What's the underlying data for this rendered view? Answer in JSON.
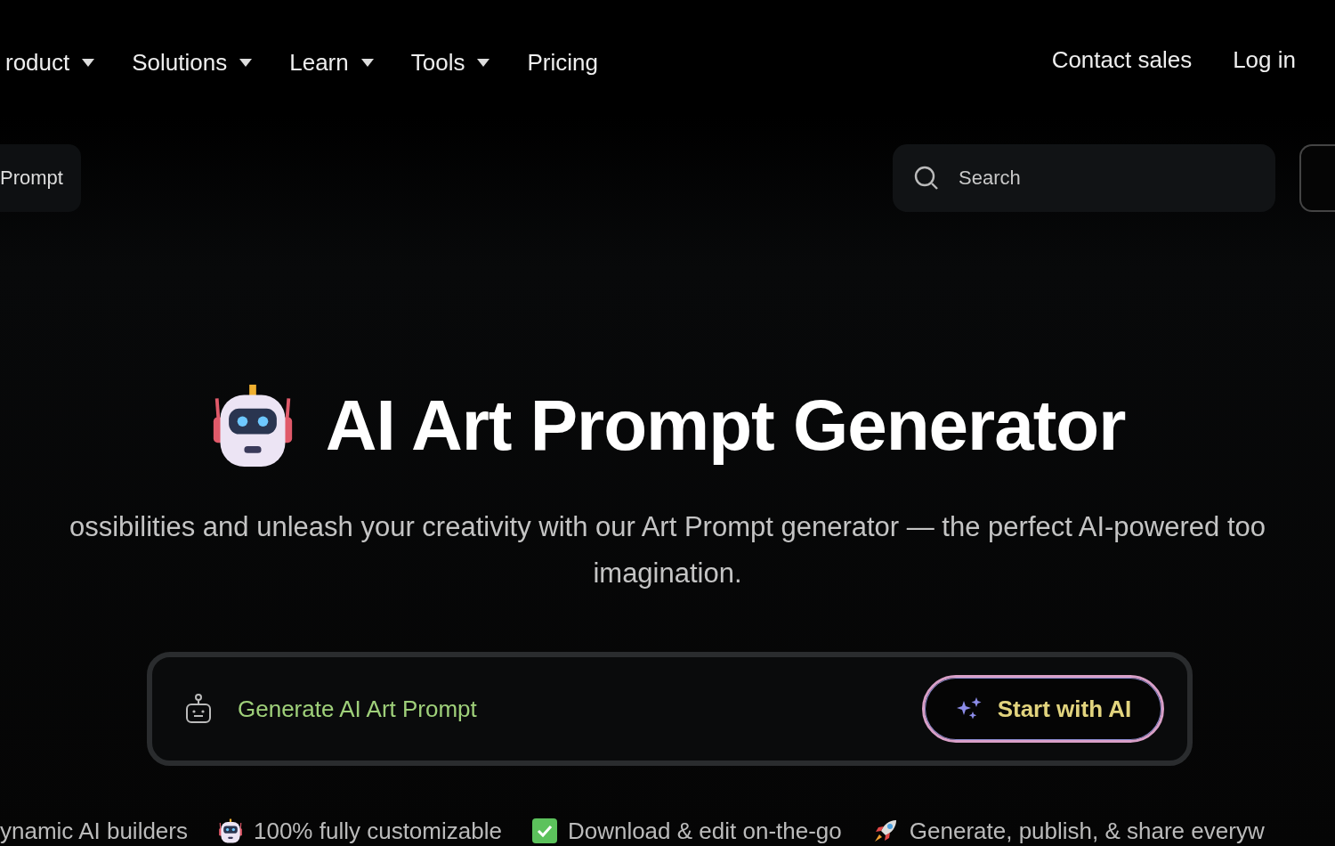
{
  "nav": {
    "items": [
      {
        "label": "roduct",
        "dropdown": true
      },
      {
        "label": "Solutions",
        "dropdown": true
      },
      {
        "label": "Learn",
        "dropdown": true
      },
      {
        "label": "Tools",
        "dropdown": true
      },
      {
        "label": "Pricing",
        "dropdown": false
      }
    ],
    "actions": [
      "Contact sales",
      "Log in"
    ]
  },
  "toolbar": {
    "chip": "Prompt",
    "search": {
      "placeholder": "Search"
    }
  },
  "hero": {
    "title": "AI Art Prompt Generator",
    "subtitle": [
      "ossibilities and unleash your creativity with our Art Prompt generator — the perfect AI-powered too",
      "imagination."
    ]
  },
  "prompt_bar": {
    "placeholder": "Generate AI Art Prompt",
    "button": "Start with AI"
  },
  "features": [
    {
      "kind": "plain",
      "text": "ynamic AI builders"
    },
    {
      "kind": "robot",
      "text": "100% fully customizable"
    },
    {
      "kind": "check",
      "text": "Download & edit on-the-go"
    },
    {
      "kind": "rocket",
      "text": "Generate, publish, & share everyw"
    }
  ]
}
